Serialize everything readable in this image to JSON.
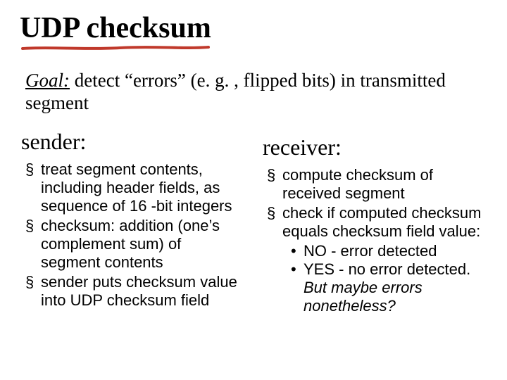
{
  "title": "UDP checksum",
  "goal": {
    "label": "Goal:",
    "text": " detect “errors” (e. g. , flipped bits) in transmitted segment"
  },
  "sender": {
    "heading": "sender:",
    "items": [
      "treat segment contents, including header fields, as sequence of 16 -bit integers",
      "checksum: addition (one’s complement sum) of segment contents",
      "sender puts checksum value into UDP checksum field"
    ]
  },
  "receiver": {
    "heading": "receiver:",
    "items": [
      "compute checksum of received segment",
      "check if computed checksum equals checksum field value:"
    ],
    "sub": {
      "no": "NO - error detected",
      "yes_a": "YES - no error detected. ",
      "yes_b": "But maybe errors nonetheless?"
    }
  }
}
